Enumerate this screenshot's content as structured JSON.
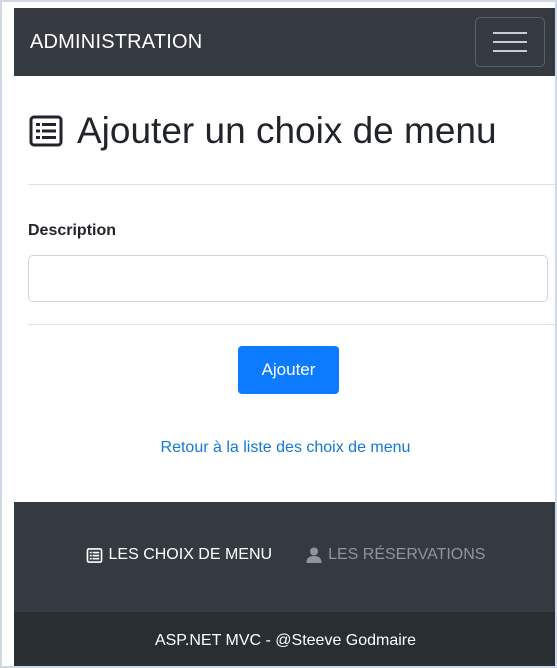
{
  "navbar": {
    "brand": "ADMINISTRATION",
    "toggler_icon": "hamburger-icon"
  },
  "page": {
    "title": "Ajouter un choix de menu",
    "title_icon": "list-icon"
  },
  "form": {
    "description_label": "Description",
    "description_value": "",
    "submit_label": "Ajouter"
  },
  "links": {
    "back": "Retour à la liste des choix de menu"
  },
  "footer_nav": {
    "items": [
      {
        "label": "LES CHOIX DE MENU",
        "icon": "list-icon",
        "state": "active"
      },
      {
        "label": "LES RÉSERVATIONS",
        "icon": "user-icon",
        "state": "muted"
      }
    ]
  },
  "footer": {
    "copyright": "ASP.NET MVC - @Steeve Godmaire"
  },
  "colors": {
    "navbar_bg": "#343a40",
    "bottom_bg": "#292e33",
    "primary": "#0d7bff",
    "link": "#1279d6",
    "muted": "#8f959b"
  }
}
